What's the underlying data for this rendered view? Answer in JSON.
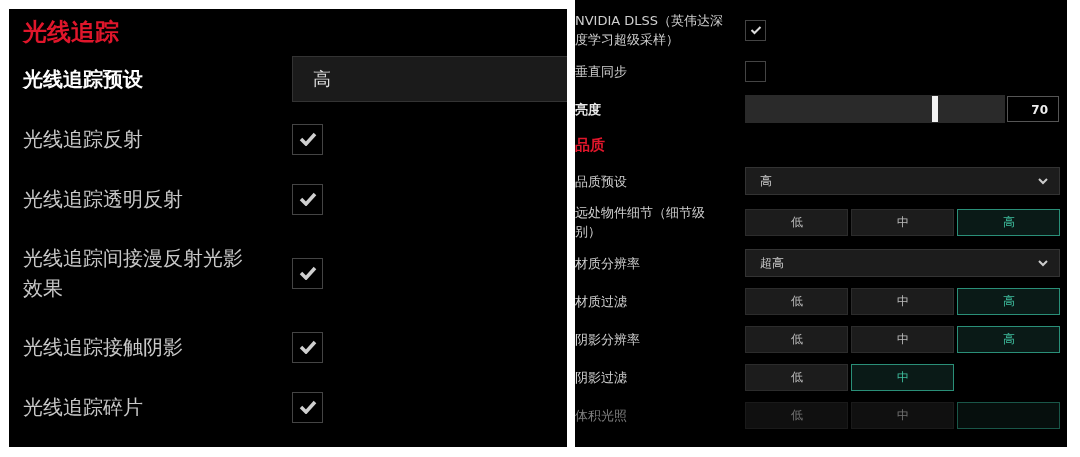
{
  "ray_tracing_panel": {
    "heading": "光线追踪",
    "rows": [
      {
        "kind": "dropdown",
        "label": "光线追踪预设",
        "value": "高"
      },
      {
        "kind": "checkbox",
        "label": "光线追踪反射",
        "checked": true
      },
      {
        "kind": "checkbox",
        "label": "光线追踪透明反射",
        "checked": true
      },
      {
        "kind": "checkbox",
        "label": "光线追踪间接漫反射光影效果",
        "checked": true
      },
      {
        "kind": "checkbox",
        "label": "光线追踪接触阴影",
        "checked": true
      },
      {
        "kind": "checkbox",
        "label": "光线追踪碎片",
        "checked": true
      }
    ]
  },
  "graphics_panel": {
    "rows": [
      {
        "kind": "checkbox",
        "label": "NVIDIA DLSS（英伟达深度学习超级采样）",
        "checked": true
      },
      {
        "kind": "checkbox",
        "label": "垂直同步",
        "checked": false
      },
      {
        "kind": "slider",
        "label": "亮度",
        "level": 0.73,
        "value": "70"
      },
      {
        "kind": "heading",
        "label": "品质"
      },
      {
        "kind": "dropdown",
        "label": "品质预设",
        "value": "高"
      },
      {
        "kind": "segmented",
        "label": "远处物件细节（细节级别）",
        "options": [
          {
            "label": "低",
            "selected": false
          },
          {
            "label": "中",
            "selected": false
          },
          {
            "label": "高",
            "selected": true
          }
        ]
      },
      {
        "kind": "dropdown",
        "label": "材质分辨率",
        "value": "超高"
      },
      {
        "kind": "segmented",
        "label": "材质过滤",
        "options": [
          {
            "label": "低",
            "selected": false
          },
          {
            "label": "中",
            "selected": false
          },
          {
            "label": "高",
            "selected": true
          }
        ]
      },
      {
        "kind": "segmented",
        "label": "阴影分辨率",
        "options": [
          {
            "label": "低",
            "selected": false
          },
          {
            "label": "中",
            "selected": false
          },
          {
            "label": "高",
            "selected": true
          }
        ]
      },
      {
        "kind": "segmented",
        "label": "阴影过滤",
        "options": [
          {
            "label": "低",
            "selected": false
          },
          {
            "label": "中",
            "selected": true
          }
        ]
      },
      {
        "kind": "segmented",
        "label": "体积光照",
        "faded": true,
        "options": [
          {
            "label": "低",
            "selected": false
          },
          {
            "label": "中",
            "selected": false
          },
          {
            "selected": true
          }
        ]
      }
    ]
  }
}
